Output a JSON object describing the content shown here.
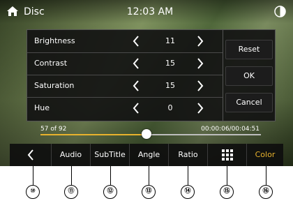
{
  "header": {
    "title": "Disc",
    "time": "12:03 AM"
  },
  "settings": {
    "rows": [
      {
        "label": "Brightness",
        "value": "11"
      },
      {
        "label": "Contrast",
        "value": "15"
      },
      {
        "label": "Saturation",
        "value": "15"
      },
      {
        "label": "Hue",
        "value": "0"
      }
    ],
    "buttons": {
      "reset": "Reset",
      "ok": "OK",
      "cancel": "Cancel"
    }
  },
  "playback": {
    "track_position": "57 of 92",
    "time": "00:00:06/00:04:51",
    "progress_fraction": 0.48
  },
  "toolbar": {
    "audio": "Audio",
    "subtitle": "SubTitle",
    "angle": "Angle",
    "ratio": "Ratio",
    "color": "Color"
  },
  "callouts": [
    "⑩",
    "⑪",
    "⑫",
    "⑬",
    "⑭",
    "⑮",
    "⑯"
  ],
  "colors": {
    "accent": "#e8b22d"
  }
}
